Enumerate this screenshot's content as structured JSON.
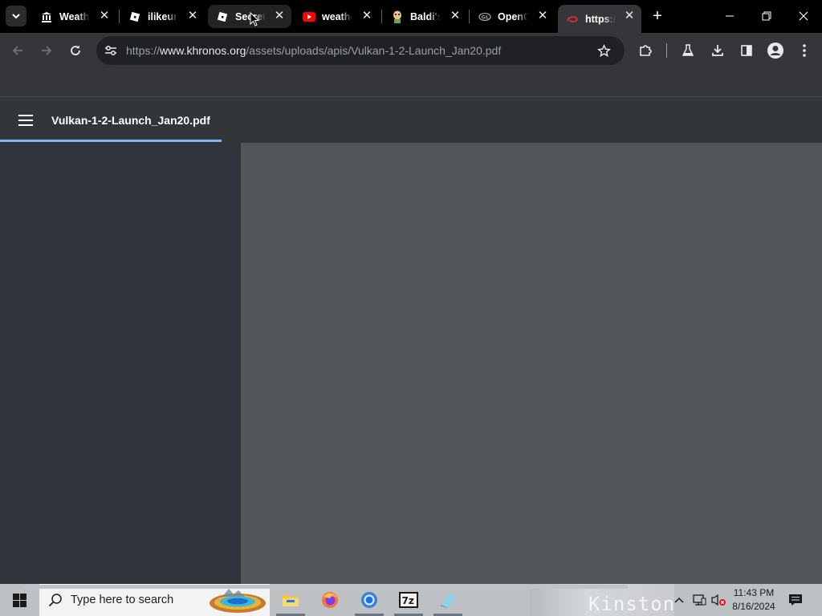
{
  "tabs": [
    {
      "title": "Weather",
      "icon": "museum-icon"
    },
    {
      "title": "ilikeurbanism",
      "icon": "roblox-icon"
    },
    {
      "title": "Secret",
      "icon": "roblox-icon"
    },
    {
      "title": "weather",
      "icon": "youtube-icon"
    },
    {
      "title": "Baldi's",
      "icon": "baldi-icon"
    },
    {
      "title": "OpenGL",
      "icon": "opengl-icon"
    },
    {
      "title": "https://",
      "icon": "khronos-icon"
    }
  ],
  "browser": {
    "url_prefix": "https://",
    "url_domain": "www.khronos.org",
    "url_path": "/assets/uploads/apis/Vulkan-1-2-Launch_Jan20.pdf",
    "close_glyph": "✕",
    "new_tab_glyph": "+"
  },
  "pdf": {
    "filename": "Vulkan-1-2-Launch_Jan20.pdf",
    "load_progress": 0.27
  },
  "taskbar": {
    "search_placeholder": "Type here to search",
    "wallpaper_text": "Kinston",
    "time": "11:43 PM",
    "date": "8/16/2024"
  },
  "colors": {
    "tab_strip": "#000000",
    "toolbar": "#35363a",
    "pdf_toolbar": "#323639",
    "pdf_sidebar": "#2f333a",
    "pdf_viewer": "#525659",
    "progress": "#8ab4f8",
    "taskbar": "#bec1c4"
  }
}
